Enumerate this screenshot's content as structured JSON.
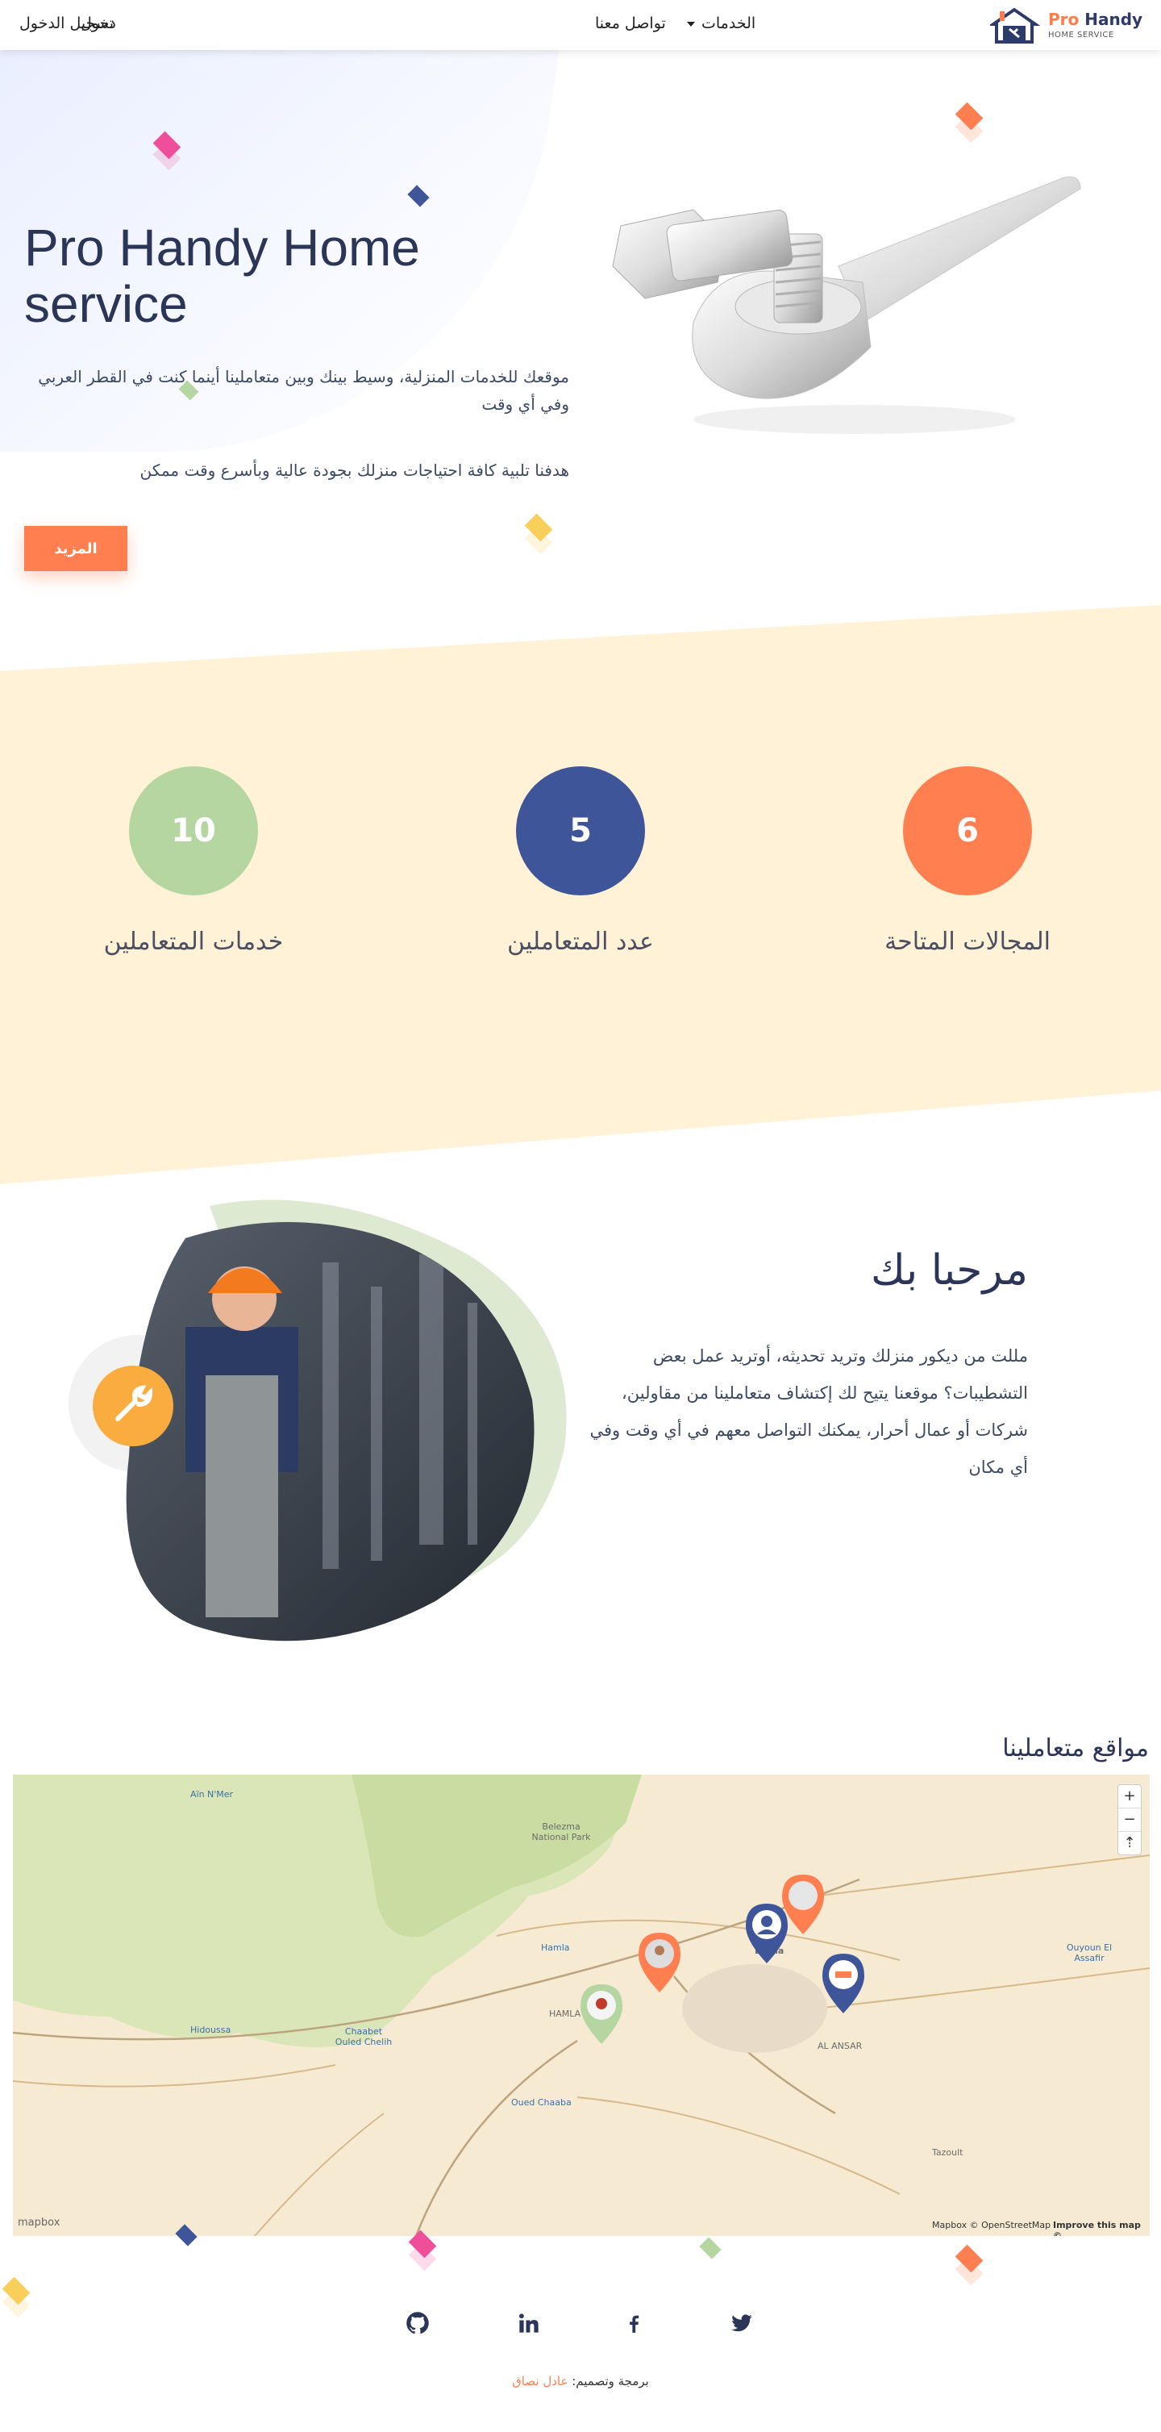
{
  "nav": {
    "brand_primary": "Pro",
    "brand_secondary": "Handy",
    "brand_tagline": "HOME SERVICE",
    "services": "الخدمات",
    "contact": "تواصل معنا",
    "login": "دخول",
    "register": "تسجيل الدخول"
  },
  "hero": {
    "title": "Pro Handy Home service",
    "paragraph_1": "موقعك للخدمات المنزلية، وسيط بينك وبين متعاملينا أينما كنت في القطر العربي وفي أي وقت",
    "paragraph_2": "هدفنا تلبية كافة احتياجات منزلك بجودة عالية وبأسرع وقت ممكن",
    "more_button": "المزيد"
  },
  "stats": [
    {
      "value": "6",
      "label": "المجالات المتاحة",
      "color": "#ff7f50"
    },
    {
      "value": "5",
      "label": "عدد المتعاملين",
      "color": "#3e5599"
    },
    {
      "value": "10",
      "label": "خدمات المتعاملين",
      "color": "#b5d6a0"
    }
  ],
  "welcome": {
    "title": "مرحبا بك",
    "paragraph": "مللت من ديكور منزلك وتريد تحديثه، أوتريد عمل بعض التشطيبات؟ موقعنا يتيح لك إكتشاف متعاملينا من مقاولين، شركات أو عمال أحرار، يمكنك التواصل معهم في أي وقت وفي أي مكان"
  },
  "map": {
    "title": "مواقع متعاملينا",
    "zoom_in": "+",
    "zoom_out": "−",
    "reset": "⇡",
    "places": {
      "ain_mer": "Aïn N'Mer",
      "belezma": "Belezma National Park",
      "hamla_1": "Hamla",
      "hamla_2": "HAMLA",
      "hidoussa": "Hidoussa",
      "chaabet": "Chaabet Ouled Chelih",
      "oued_chaaba": "Oued Chaaba",
      "batna": "Batna",
      "al_ansar": "AL ANSAR",
      "ouyoun": "Ouyoun El Assafir",
      "tazoult": "Tazoult"
    },
    "logo": "mapbox",
    "attribution": "Mapbox © OpenStreetMap",
    "improve": "Improve this map ©"
  },
  "footer": {
    "credit_prefix": "برمجة وتصميم:",
    "credit_name": "عادل نصاق",
    "social": [
      "github-icon",
      "linkedin-icon",
      "facebook-icon",
      "twitter-icon"
    ]
  },
  "colors": {
    "accent": "#ff7f50",
    "navy": "#2a3558",
    "cream": "#fff2d6",
    "green": "#b5d6a0"
  }
}
